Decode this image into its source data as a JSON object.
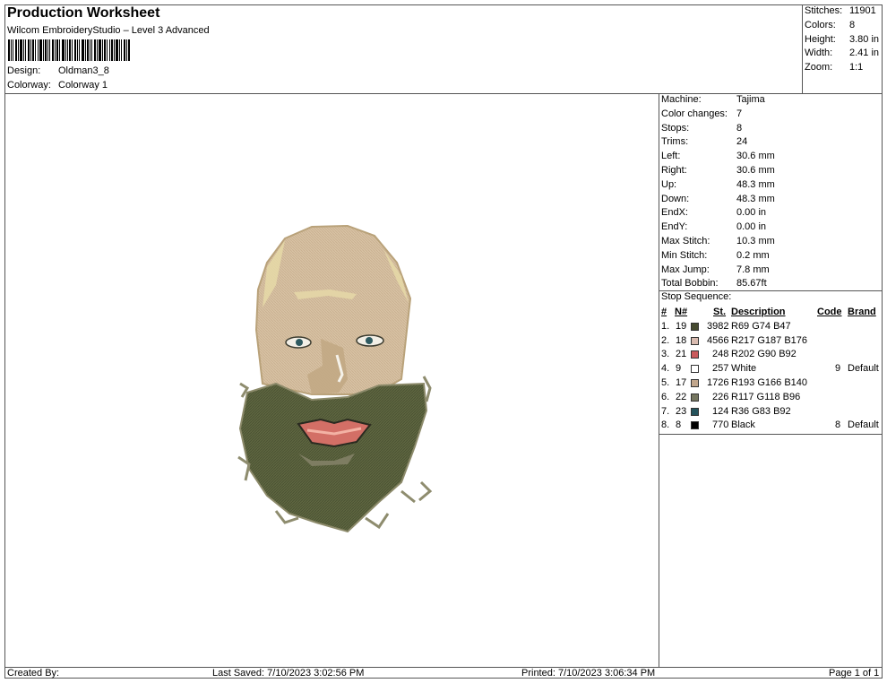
{
  "header": {
    "title": "Production Worksheet",
    "subtitle": "Wilcom EmbroideryStudio – Level 3 Advanced",
    "design_label": "Design:",
    "design_value": "Oldman3_8",
    "colorway_label": "Colorway:",
    "colorway_value": "Colorway 1"
  },
  "summary": [
    {
      "k": "Stitches:",
      "v": "11901"
    },
    {
      "k": "Colors:",
      "v": "8"
    },
    {
      "k": "Height:",
      "v": "3.80 in"
    },
    {
      "k": "Width:",
      "v": "2.41 in"
    },
    {
      "k": "Zoom:",
      "v": "1:1"
    }
  ],
  "details": [
    {
      "k": "Machine:",
      "v": "Tajima"
    },
    {
      "k": "Color changes:",
      "v": "7"
    },
    {
      "k": "Stops:",
      "v": "8"
    },
    {
      "k": "Trims:",
      "v": "24"
    },
    {
      "k": "Left:",
      "v": "30.6 mm"
    },
    {
      "k": "Right:",
      "v": "30.6 mm"
    },
    {
      "k": "Up:",
      "v": "48.3 mm"
    },
    {
      "k": "Down:",
      "v": "48.3 mm"
    },
    {
      "k": "EndX:",
      "v": "0.00 in"
    },
    {
      "k": "EndY:",
      "v": "0.00 in"
    },
    {
      "k": "Max Stitch:",
      "v": "10.3 mm"
    },
    {
      "k": "Min Stitch:",
      "v": "0.2 mm"
    },
    {
      "k": "Max Jump:",
      "v": "7.8 mm"
    },
    {
      "k": "Total Bobbin:",
      "v": "85.67ft"
    }
  ],
  "stops": {
    "label": "Stop Sequence:",
    "headers": {
      "num": "#",
      "n": "N#",
      "st": "St.",
      "desc": "Description",
      "code": "Code",
      "brand": "Brand"
    },
    "rows": [
      {
        "num": "1.",
        "n": "19",
        "color": "#454A2F",
        "st": "3982",
        "desc": "R69 G74 B47",
        "code": "",
        "brand": ""
      },
      {
        "num": "2.",
        "n": "18",
        "color": "#D9BBB0",
        "st": "4566",
        "desc": "R217 G187 B176",
        "code": "",
        "brand": ""
      },
      {
        "num": "3.",
        "n": "21",
        "color": "#CA5A5C",
        "st": "248",
        "desc": "R202 G90 B92",
        "code": "",
        "brand": ""
      },
      {
        "num": "4.",
        "n": "9",
        "color": "#FFFFFF",
        "st": "257",
        "desc": "White",
        "code": "9",
        "brand": "Default"
      },
      {
        "num": "5.",
        "n": "17",
        "color": "#C1A68C",
        "st": "1726",
        "desc": "R193 G166 B140",
        "code": "",
        "brand": ""
      },
      {
        "num": "6.",
        "n": "22",
        "color": "#757660",
        "st": "226",
        "desc": "R117 G118 B96",
        "code": "",
        "brand": ""
      },
      {
        "num": "7.",
        "n": "23",
        "color": "#24535C",
        "st": "124",
        "desc": "R36 G83 B92",
        "code": "",
        "brand": ""
      },
      {
        "num": "8.",
        "n": "8",
        "color": "#000000",
        "st": "770",
        "desc": "Black",
        "code": "8",
        "brand": "Default"
      }
    ]
  },
  "footer": {
    "created": "Created By:",
    "saved": "Last Saved: 7/10/2023 3:02:56 PM",
    "printed": "Printed: 7/10/2023 3:06:34 PM",
    "page": "Page 1 of 1"
  }
}
